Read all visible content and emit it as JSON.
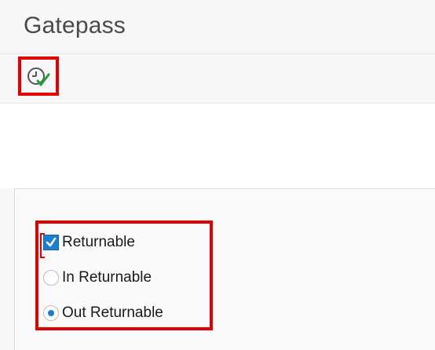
{
  "window": {
    "title": "Gatepass"
  },
  "toolbar": {
    "execute_icon": "clock-execute-check-icon"
  },
  "options": {
    "checkbox": {
      "label": "Returnable",
      "checked": true
    },
    "radios": [
      {
        "label": "In Returnable",
        "selected": false
      },
      {
        "label": "Out Returnable",
        "selected": true
      }
    ]
  },
  "colors": {
    "highlight_red": "#e00000",
    "accent_blue": "#1b7fd1",
    "title_gray": "#4a4a4a"
  }
}
